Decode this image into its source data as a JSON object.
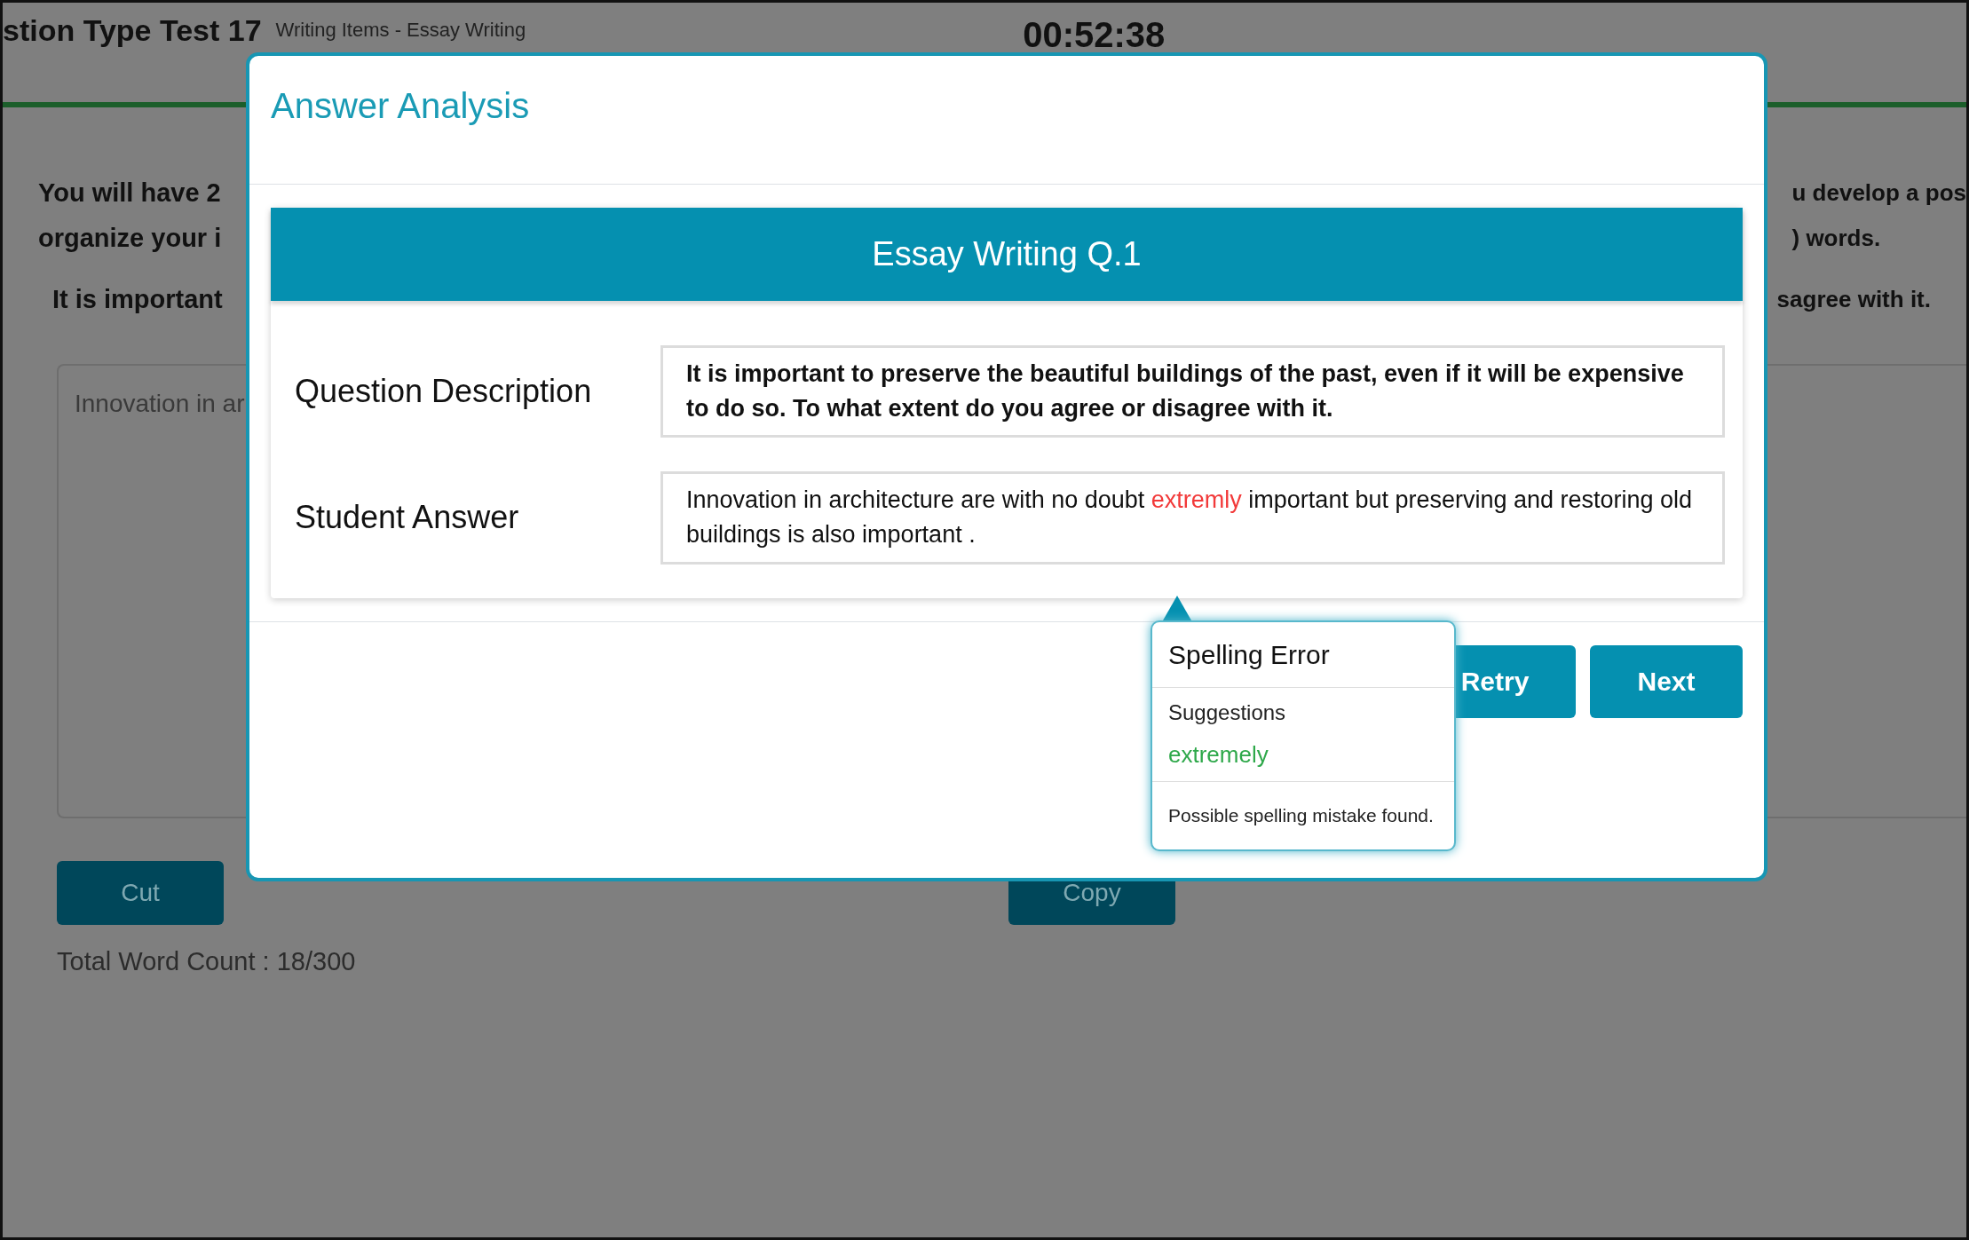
{
  "background": {
    "header_title": "stion Type Test 17",
    "header_subtitle": "Writing Items - Essay Writing",
    "timer": "00:52:38",
    "instructions_left": [
      "You will have 2",
      "organize your i"
    ],
    "instructions_right": [
      "u develop a pos",
      ") words."
    ],
    "prompt_left": "It is important",
    "prompt_right": "sagree with it.",
    "answer_value": "Innovation in ar",
    "buttons": [
      "Cut",
      "Copy"
    ],
    "word_count": "Total Word Count : 18/300"
  },
  "modal": {
    "title": "Answer Analysis",
    "card_title": "Essay Writing Q.1",
    "rows": [
      {
        "label": "Question Description",
        "kind": "question",
        "segments": [
          {
            "kind": "plain",
            "text": "It is important to preserve the beautiful buildings of the past, even if it will be expensive to do so. To what extent do you agree or disagree with it."
          }
        ]
      },
      {
        "label": "Student Answer",
        "kind": "answer",
        "segments": [
          {
            "kind": "plain",
            "text": "Innovation in architecture are with no doubt "
          },
          {
            "kind": "error",
            "text": "extremly"
          },
          {
            "kind": "plain",
            "text": " important but preserving and restoring old buildings is also important ."
          }
        ]
      }
    ],
    "buttons": [
      "Retry",
      "Next"
    ]
  },
  "tooltip": {
    "title": "Spelling Error",
    "suggestions_label": "Suggestions",
    "suggestions": [
      "extremely"
    ],
    "message": "Possible spelling mistake found."
  }
}
